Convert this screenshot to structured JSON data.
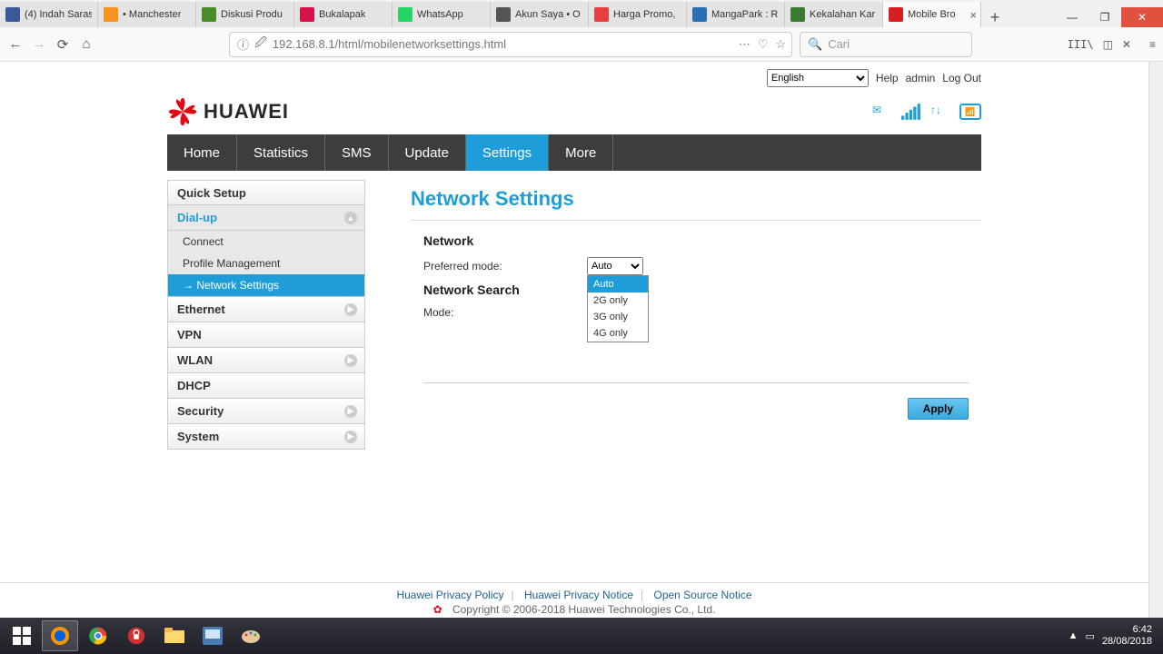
{
  "browser": {
    "tabs": [
      {
        "label": "(4) Indah Saras",
        "fav": "#3b5998"
      },
      {
        "label": "• Manchester",
        "fav": "#f7921e"
      },
      {
        "label": "Diskusi Produ",
        "fav": "#4b8b2b"
      },
      {
        "label": "Bukalapak",
        "fav": "#d71149"
      },
      {
        "label": "WhatsApp",
        "fav": "#25d366"
      },
      {
        "label": "Akun Saya • O",
        "fav": "#555"
      },
      {
        "label": "Harga Promo,",
        "fav": "#e63f3f"
      },
      {
        "label": "MangaPark : R",
        "fav": "#2b6fb3"
      },
      {
        "label": "Kekalahan Kar",
        "fav": "#3a7d2e"
      },
      {
        "label": "Mobile Bro",
        "fav": "#d61f1f",
        "active": true
      }
    ],
    "url": "192.168.8.1/html/mobilenetworksettings.html",
    "search_placeholder": "Cari"
  },
  "header": {
    "language": "English",
    "help": "Help",
    "user": "admin",
    "logout": "Log Out",
    "brand": "HUAWEI"
  },
  "nav": {
    "items": [
      "Home",
      "Statistics",
      "SMS",
      "Update",
      "Settings",
      "More"
    ],
    "active": "Settings"
  },
  "sidebar": {
    "items": [
      {
        "label": "Quick Setup"
      },
      {
        "label": "Dial-up",
        "expandable": true,
        "expanded": true,
        "children": [
          {
            "label": "Connect"
          },
          {
            "label": "Profile Management"
          },
          {
            "label": "Network Settings",
            "selected": true
          }
        ]
      },
      {
        "label": "Ethernet",
        "expandable": true
      },
      {
        "label": "VPN"
      },
      {
        "label": "WLAN",
        "expandable": true
      },
      {
        "label": "DHCP"
      },
      {
        "label": "Security",
        "expandable": true
      },
      {
        "label": "System",
        "expandable": true
      }
    ]
  },
  "page": {
    "title": "Network Settings",
    "section1": "Network",
    "preferred_label": "Preferred mode:",
    "preferred_value": "Auto",
    "dropdown_options": [
      "Auto",
      "2G only",
      "3G only",
      "4G only"
    ],
    "section2": "Network Search",
    "mode_label": "Mode:",
    "apply": "Apply"
  },
  "footer": {
    "links": [
      "Huawei Privacy Policy",
      "Huawei Privacy Notice",
      "Open Source Notice"
    ],
    "copyright": "Copyright © 2006-2018 Huawei Technologies Co., Ltd."
  },
  "taskbar": {
    "time": "6:42",
    "date": "28/08/2018"
  }
}
